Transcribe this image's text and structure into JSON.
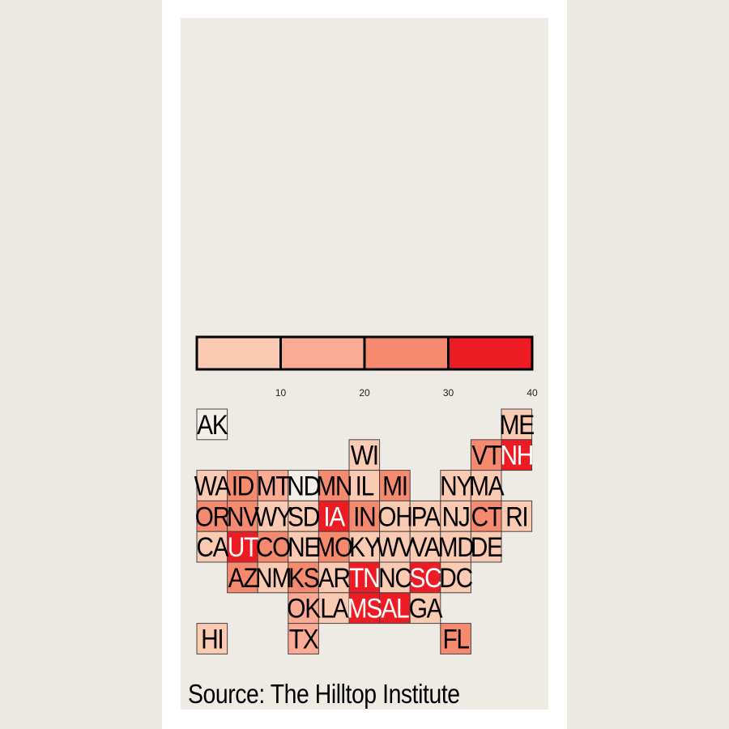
{
  "source": "Source: The Hilltop Institute",
  "chart_data": {
    "type": "tile-grid-map",
    "legend": {
      "placement": "top",
      "bins": [
        {
          "from": 0,
          "to": 10,
          "color": "#fbcab3"
        },
        {
          "from": 10,
          "to": 20,
          "color": "#fbaa94"
        },
        {
          "from": 20,
          "to": 30,
          "color": "#f68a6e"
        },
        {
          "from": 30,
          "to": 40,
          "color": "#ed1c24"
        }
      ],
      "tick_labels": [
        "10",
        "20",
        "30",
        "40"
      ]
    },
    "tiles": [
      {
        "state": "AK",
        "bin": null
      },
      {
        "state": "ME",
        "bin": 0
      },
      {
        "state": "WI",
        "bin": 0
      },
      {
        "state": "VT",
        "bin": 2
      },
      {
        "state": "NH",
        "bin": 3
      },
      {
        "state": "WA",
        "bin": 0
      },
      {
        "state": "ID",
        "bin": 2
      },
      {
        "state": "MT",
        "bin": 1
      },
      {
        "state": "ND",
        "bin": null
      },
      {
        "state": "MN",
        "bin": 2
      },
      {
        "state": "IL",
        "bin": 0
      },
      {
        "state": "MI",
        "bin": 2
      },
      {
        "state": "NY",
        "bin": 0
      },
      {
        "state": "MA",
        "bin": 0
      },
      {
        "state": "OR",
        "bin": 2
      },
      {
        "state": "NV",
        "bin": 2
      },
      {
        "state": "WY",
        "bin": 0
      },
      {
        "state": "SD",
        "bin": 0
      },
      {
        "state": "IA",
        "bin": 3
      },
      {
        "state": "IN",
        "bin": 2
      },
      {
        "state": "OH",
        "bin": 0
      },
      {
        "state": "PA",
        "bin": 0
      },
      {
        "state": "NJ",
        "bin": 0
      },
      {
        "state": "CT",
        "bin": 2
      },
      {
        "state": "RI",
        "bin": 0
      },
      {
        "state": "CA",
        "bin": 0
      },
      {
        "state": "UT",
        "bin": 3
      },
      {
        "state": "CO",
        "bin": 2
      },
      {
        "state": "NE",
        "bin": 0
      },
      {
        "state": "MO",
        "bin": 2
      },
      {
        "state": "KY",
        "bin": 0
      },
      {
        "state": "WV",
        "bin": 0
      },
      {
        "state": "VA",
        "bin": 0
      },
      {
        "state": "MD",
        "bin": 0
      },
      {
        "state": "DE",
        "bin": 0
      },
      {
        "state": "AZ",
        "bin": 2
      },
      {
        "state": "NM",
        "bin": 0
      },
      {
        "state": "KS",
        "bin": 2
      },
      {
        "state": "AR",
        "bin": 0
      },
      {
        "state": "TN",
        "bin": 3
      },
      {
        "state": "NC",
        "bin": 0
      },
      {
        "state": "SC",
        "bin": 3
      },
      {
        "state": "DC",
        "bin": 0
      },
      {
        "state": "OK",
        "bin": 1
      },
      {
        "state": "LA",
        "bin": 0
      },
      {
        "state": "MS",
        "bin": 3
      },
      {
        "state": "AL",
        "bin": 3
      },
      {
        "state": "GA",
        "bin": 0
      },
      {
        "state": "HI",
        "bin": 0
      },
      {
        "state": "TX",
        "bin": 1
      },
      {
        "state": "FL",
        "bin": 2
      }
    ]
  }
}
